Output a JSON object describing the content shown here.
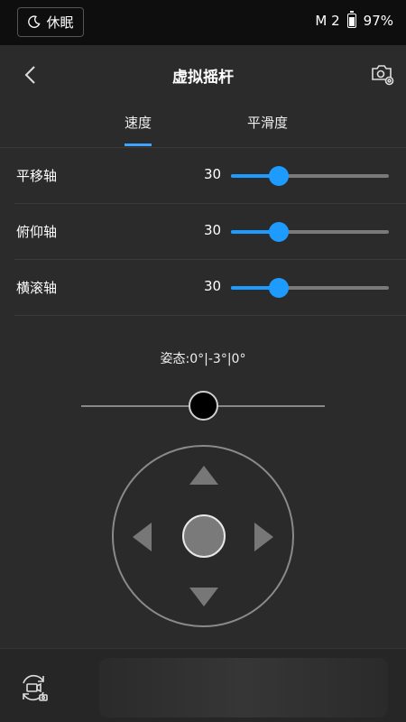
{
  "status": {
    "sleep_label": "休眠",
    "device": "M 2",
    "battery": "97%"
  },
  "header": {
    "title": "虚拟摇杆"
  },
  "tabs": [
    {
      "label": "速度",
      "active": true
    },
    {
      "label": "平滑度",
      "active": false
    }
  ],
  "rows": [
    {
      "label": "平移轴",
      "value": "30",
      "level": 30
    },
    {
      "label": "俯仰轴",
      "value": "30",
      "level": 30
    },
    {
      "label": "横滚轴",
      "value": "30",
      "level": 30
    }
  ],
  "attitude": "姿态:0°|-3°|0°",
  "horizontal_slider_level": 50,
  "colors": {
    "accent": "#1e9bff",
    "background": "#2b2b2b",
    "status_bar": "#0e0e0e"
  },
  "icons": {
    "sleep": "moon-icon",
    "battery": "battery-icon",
    "back": "chevron-left-icon",
    "camera_settings": "camera-settings-icon",
    "mode_switch": "camera-switch-icon"
  }
}
